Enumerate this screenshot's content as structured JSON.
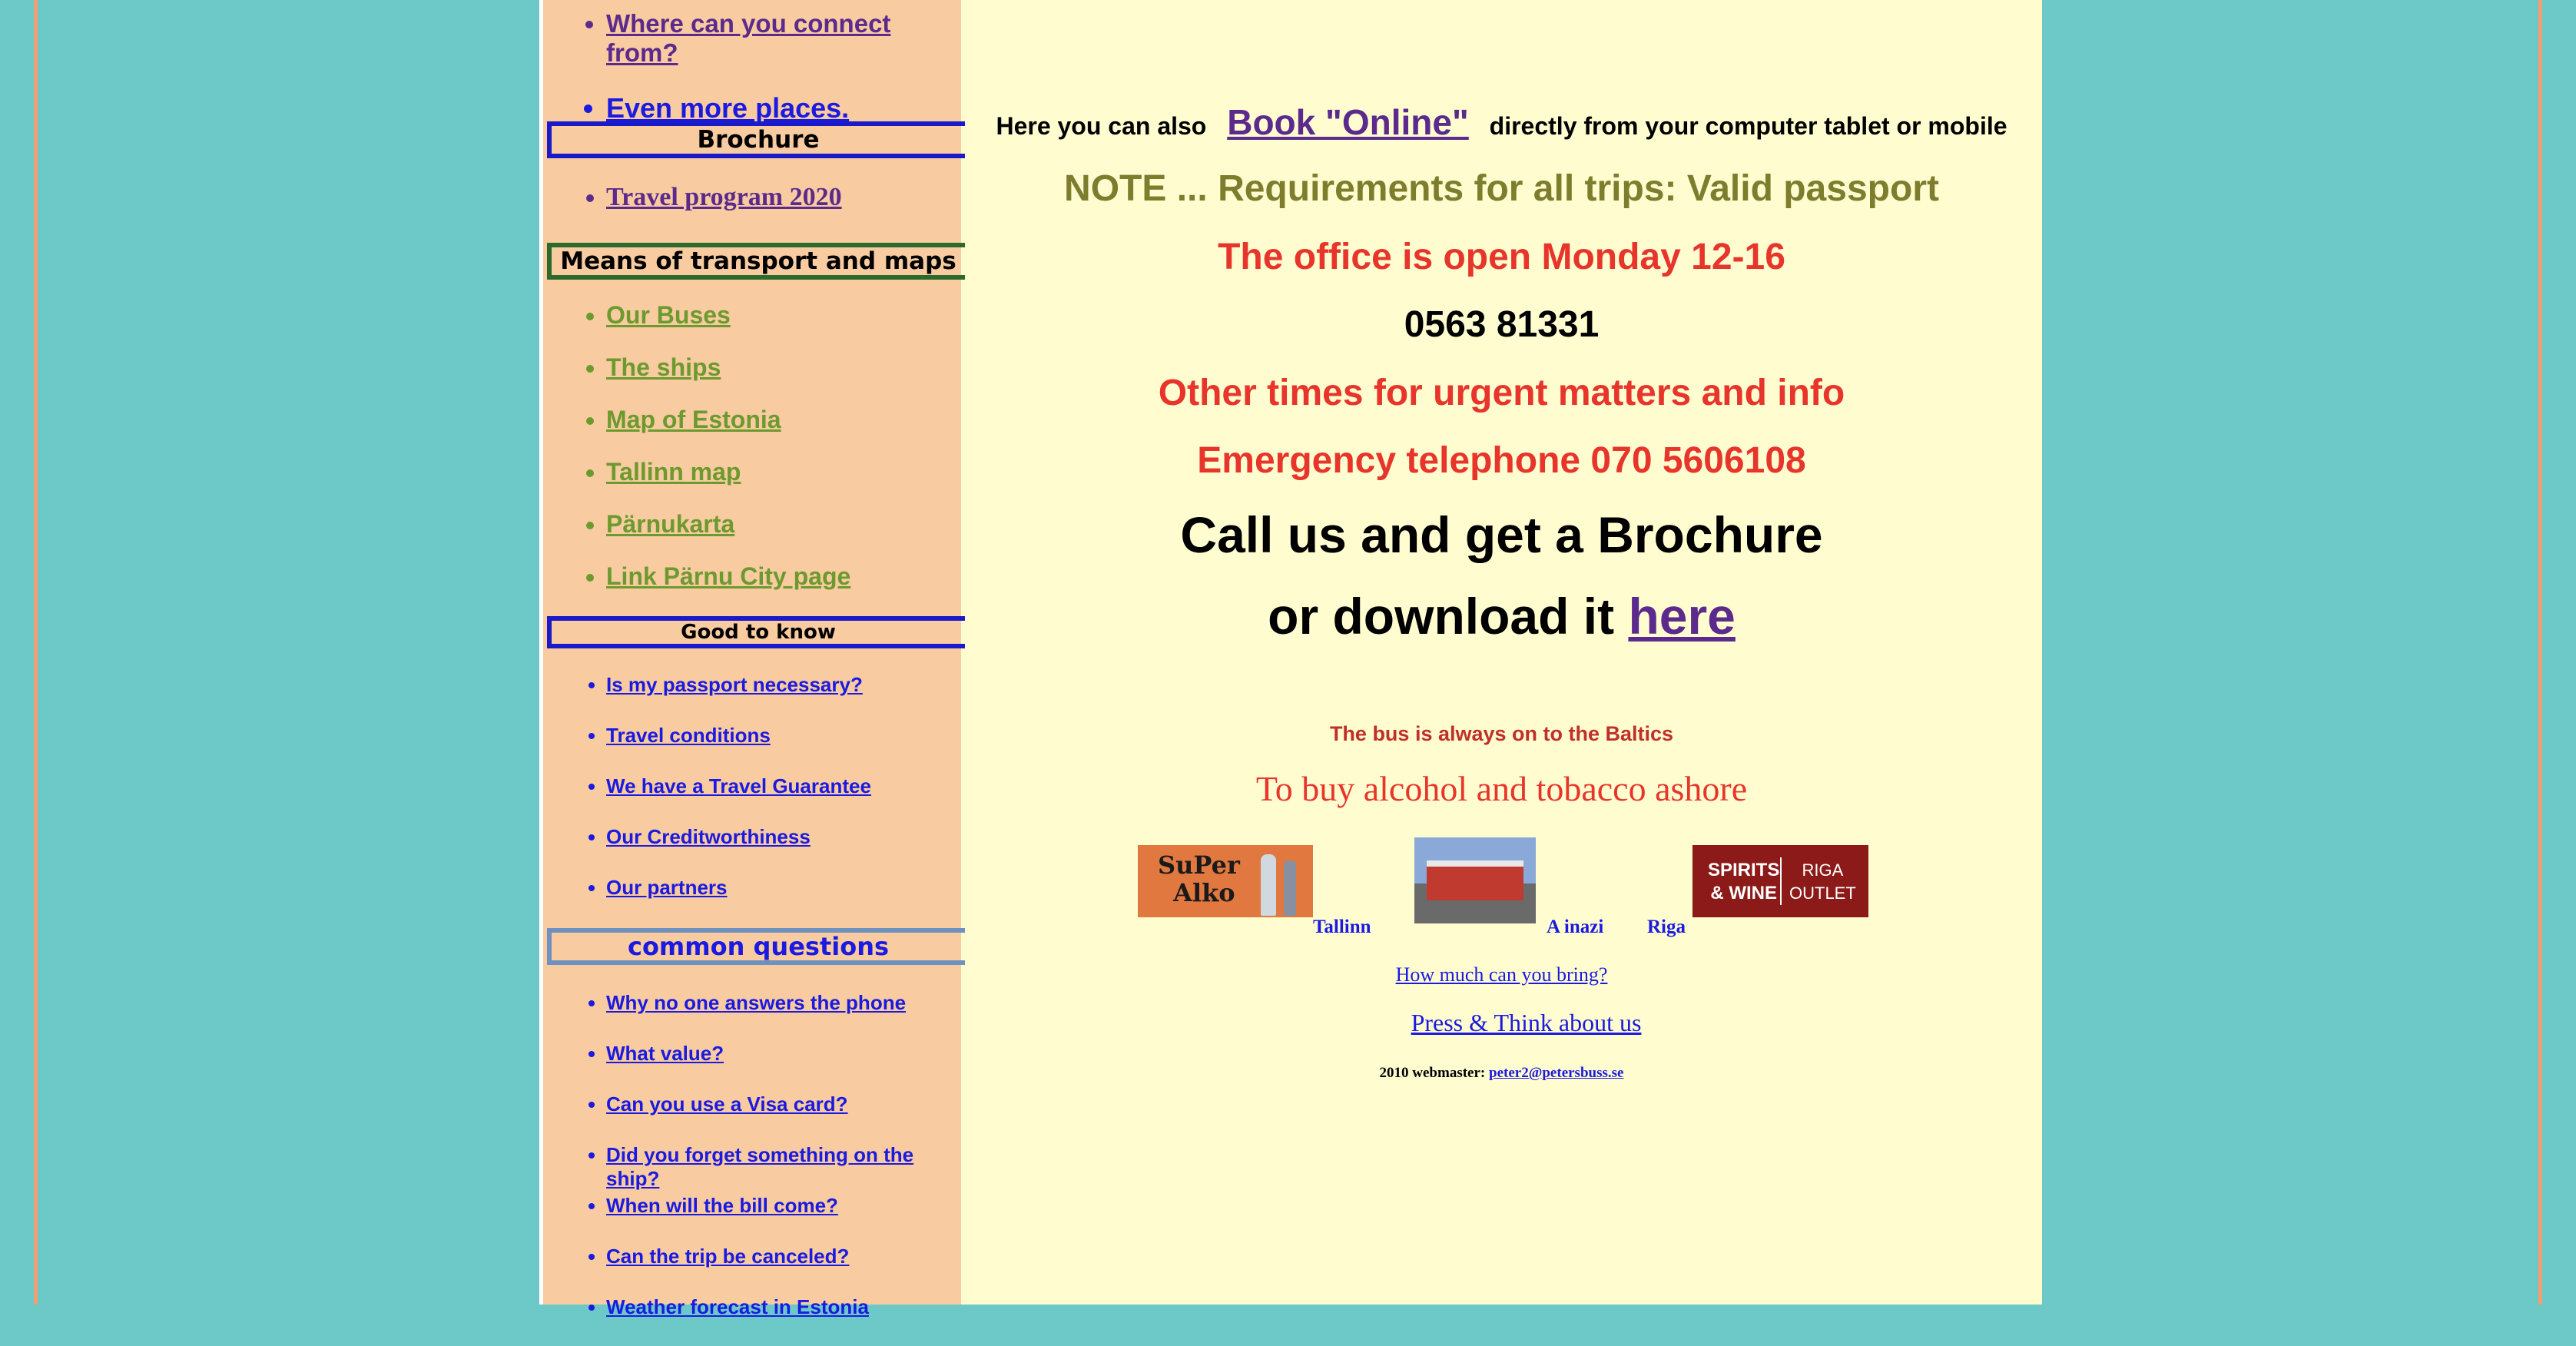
{
  "sidebar": {
    "top_links": [
      {
        "label": "Where can you connect from?",
        "color": "#5b2a8c"
      },
      {
        "label": "Even more places.",
        "color": "#1a1ae0"
      }
    ],
    "brochure_heading": "Brochure",
    "brochure_link": "Travel program 2020",
    "transport_heading": "Means of transport and maps",
    "transport_links": [
      "Our Buses",
      "The ships",
      "Map of Estonia",
      "Tallinn map",
      "Pärnukarta",
      "Link Pärnu City page"
    ],
    "good_heading": "Good to know",
    "good_links": [
      "Is my passport necessary?",
      "Travel conditions",
      "We have a Travel Guarantee ",
      "Our Creditworthiness ",
      "Our partners"
    ],
    "questions_heading": "common questions",
    "question_links": [
      "Why no one answers the phone",
      "What value? ",
      "Can you use a Visa card?",
      "Did you forget something on the ship? ",
      "When will the bill come?",
      "Can the trip be canceled?",
      "Weather forecast in Estonia"
    ]
  },
  "main": {
    "book_prefix": "Here you can also",
    "book_link": "Book \"Online\"",
    "book_suffix": "directly from your computer tablet or mobile",
    "note": "NOTE ... Requirements for all trips: Valid passport",
    "office": "The office is open Monday 12-16",
    "phone": "0563 81331",
    "other_times": "Other times for urgent matters and info",
    "emergency": "Emergency telephone 070 5606108",
    "call_brochure": "Call us and get a Brochure",
    "download_prefix": "or download it",
    "download_link": "here",
    "bus_baltics": "The bus is always on to the Baltics",
    "alcohol": "To buy alcohol and tobacco ashore",
    "sponsors": {
      "super_alko_line1": "SuPer",
      "super_alko_line2": "Alko",
      "tallinn": "Tallinn",
      "ainazi": "A inazi",
      "riga": "Riga",
      "spirits_line1": "SPIRITS",
      "spirits_line2": "& WINE",
      "riga_outlet_line1": "RIGA",
      "riga_outlet_line2": "OUTLET"
    },
    "how_much": "How much can you bring?",
    "press": "Press & Think about us",
    "footer_prefix": "2010 webmaster:",
    "footer_email": "peter2@petersbuss.se"
  },
  "colors": {
    "background": "#6cc9c8",
    "page": "#fffdd0",
    "sidebar": "#f8cba0",
    "olive": "#7d7d2d",
    "red": "#e8352b",
    "link_blue": "#1a1ae0",
    "link_purple": "#5b2a8c",
    "transport_green": "#6c9a2e"
  }
}
